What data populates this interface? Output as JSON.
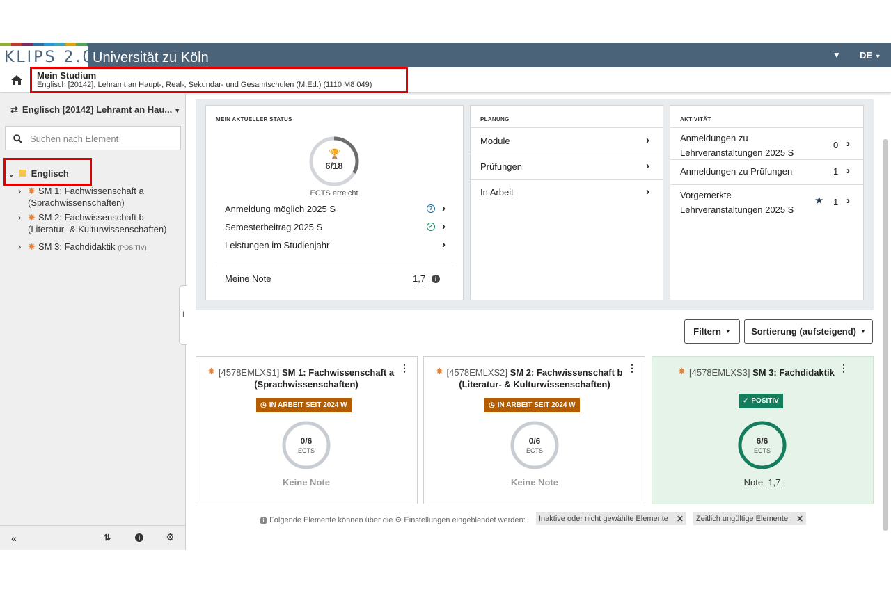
{
  "header": {
    "logo": "KLIPS 2.0",
    "university": "Universität zu Köln",
    "language": "DE",
    "colors": {
      "bar": "#4a6379"
    }
  },
  "breadcrumb": {
    "title": "Mein Studium",
    "subtitle": "Englisch [20142], Lehramt an Haupt-, Real-, Sekundar- und Gesamtschulen (M.Ed.) (1110 M8 049)"
  },
  "sidebar": {
    "program_switch": "Englisch [20142] Lehramt an Hau...",
    "search_placeholder": "Suchen nach Element",
    "root": "Englisch",
    "items": [
      {
        "label_line1": "SM 1: Fachwissenschaft a",
        "label_line2": "(Sprachwissenschaften)"
      },
      {
        "label_line1": "SM 2: Fachwissenschaft b",
        "label_line2": "(Literatur- & Kulturwissenschaften)"
      },
      {
        "label_line1": "SM 3: Fachdidaktik",
        "status": "(POSITIV)"
      }
    ]
  },
  "status": {
    "header": "MEIN AKTUELLER STATUS",
    "ects_value": "6/18",
    "ects_progress": 0.333,
    "ects_caption": "ECTS erreicht",
    "rows": [
      {
        "label": "Anmeldung möglich 2025 S",
        "icon": "question-circle-icon"
      },
      {
        "label": "Semesterbeitrag 2025 S",
        "icon": "check-circle-icon"
      },
      {
        "label": "Leistungen im Studienjahr"
      }
    ],
    "grade_label": "Meine Note",
    "grade_value": "1,7"
  },
  "planning": {
    "header": "PLANUNG",
    "rows": [
      "Module",
      "Prüfungen",
      "In Arbeit"
    ]
  },
  "activity": {
    "header": "AKTIVITÄT",
    "rows": [
      {
        "line1": "Anmeldungen zu",
        "line2": "Lehrveranstaltungen 2025 S",
        "count": "0"
      },
      {
        "line1": "Anmeldungen zu Prüfungen",
        "count": "1"
      },
      {
        "line1": "Vorgemerkte",
        "line2": "Lehrveranstaltungen 2025 S",
        "count": "1"
      }
    ]
  },
  "toolbar": {
    "filter": "Filtern",
    "sort": "Sortierung (aufsteigend)"
  },
  "modules": [
    {
      "code": "[4578EMLXS1]",
      "title1": "SM 1: Fachwissenschaft a",
      "title2": "(Sprachwissenschaften)",
      "badge": "IN ARBEIT SEIT 2024 W",
      "ects": "0/6",
      "unit": "ECTS",
      "progress": 0,
      "note": "Keine Note"
    },
    {
      "code": "[4578EMLXS2]",
      "title1": "SM 2: Fachwissenschaft b",
      "title2": "(Literatur- & Kulturwissenschaften)",
      "badge": "IN ARBEIT SEIT 2024 W",
      "ects": "0/6",
      "unit": "ECTS",
      "progress": 0,
      "note": "Keine Note"
    },
    {
      "code": "[4578EMLXS3]",
      "title1": "SM 3: Fachdidaktik",
      "badge": "POSITIV",
      "ects": "6/6",
      "unit": "ECTS",
      "progress": 1,
      "note_label": "Note",
      "note_value": "1,7"
    }
  ],
  "hint": {
    "text_a": "Folgende Elemente können über die",
    "text_b": "Einstellungen eingeblendet werden:",
    "chips": [
      "Inaktive oder nicht gewählte Elemente",
      "Zeitlich ungültige Elemente"
    ]
  }
}
